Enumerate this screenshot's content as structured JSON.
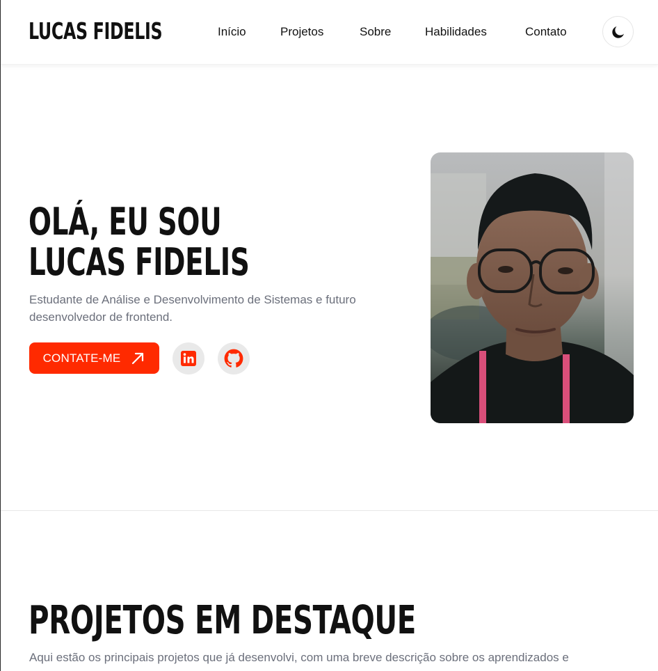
{
  "header": {
    "logo": "LUCAS FIDELIS",
    "nav": [
      "Início",
      "Projetos",
      "Sobre",
      "Habilidades",
      "Contato"
    ],
    "theme_icon": "moon-icon"
  },
  "hero": {
    "title_line1": "OLÁ, EU SOU",
    "title_line2": "LUCAS FIDELIS",
    "subtitle": "Estudante de Análise e Desenvolvimento de Sistemas e futuro desenvolvedor de frontend.",
    "cta_label": "CONTATE-ME",
    "cta_icon": "arrow-up-right-icon",
    "socials": [
      "linkedin-icon",
      "github-icon"
    ],
    "accent_color": "#ff2a00"
  },
  "projects": {
    "title": "PROJETOS EM DESTAQUE",
    "subtitle": "Aqui estão os principais projetos que já desenvolvi, com uma breve descrição sobre os aprendizados e"
  }
}
